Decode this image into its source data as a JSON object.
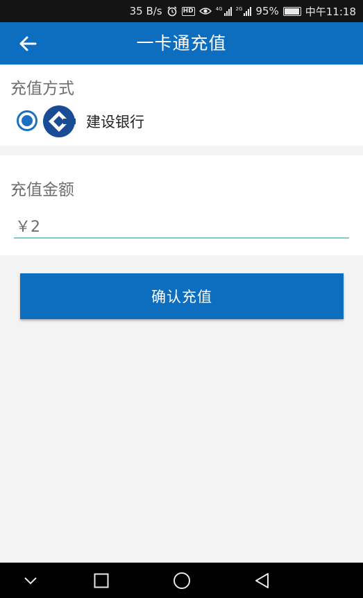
{
  "status_bar": {
    "speed": "35 B/s",
    "hd_label": "HD",
    "sim1_label": "4G",
    "sim2_label": "2G",
    "battery_percent": "95%",
    "time": "中午11:18",
    "icons": [
      "alarm-icon",
      "hd-icon",
      "eye-icon",
      "signal-icon",
      "battery-icon"
    ]
  },
  "app_bar": {
    "back_icon": "arrow-left-icon",
    "title": "一卡通充值",
    "color": "#0d6ebf"
  },
  "payment_method": {
    "label": "充值方式",
    "selected": true,
    "bank_logo": "ccb-logo",
    "bank_name": "建设银行"
  },
  "amount": {
    "label": "充值金额",
    "value": "￥2",
    "underline_color": "#7fc9c8"
  },
  "confirm_button": {
    "label": "确认充值"
  },
  "nav_bar": {
    "icons": [
      "chevron-down-icon",
      "square-icon",
      "circle-icon",
      "triangle-back-icon"
    ]
  }
}
